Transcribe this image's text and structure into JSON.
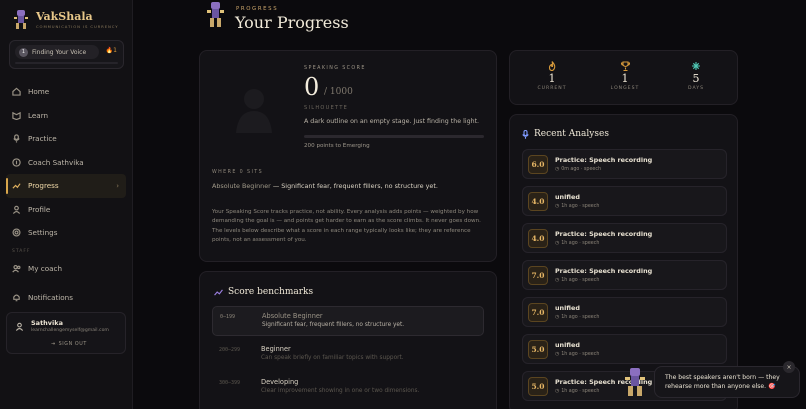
{
  "app": {
    "name": "VakShala",
    "tagline": "COMMUNICATION IS CURRENCY"
  },
  "level_card": {
    "level_number": "1",
    "level_name": "Finding Your Voice",
    "streak": "1"
  },
  "nav": {
    "items": [
      {
        "label": "Home",
        "icon": "home-icon"
      },
      {
        "label": "Learn",
        "icon": "book-icon"
      },
      {
        "label": "Practice",
        "icon": "mic-icon"
      },
      {
        "label": "Coach Sathvika",
        "icon": "coach-icon"
      },
      {
        "label": "Progress",
        "icon": "chart-icon",
        "active": true
      },
      {
        "label": "Profile",
        "icon": "user-icon"
      },
      {
        "label": "Settings",
        "icon": "gear-icon"
      }
    ],
    "staff_section": "STAFF",
    "staff_items": [
      {
        "label": "My coach",
        "icon": "users-icon"
      }
    ],
    "notifications": "Notifications"
  },
  "user": {
    "name": "Sathvika",
    "email": "learnchallengemyself@gmail.com",
    "sign_out": "SIGN OUT"
  },
  "header": {
    "kicker": "PROGRESS",
    "title": "Your Progress"
  },
  "score": {
    "kicker": "SPEAKING SCORE",
    "value": "0",
    "max": "/ 1000",
    "tier": "SILHOUETTE",
    "description": "A dark outline on an empty stage. Just finding the light.",
    "progress_fraction": 0,
    "next": "200 points to Emerging",
    "where_kicker": "WHERE 0 SITS",
    "where_level": "Absolute Beginner",
    "where_desc": " — Significant fear, frequent fillers, no structure yet.",
    "paragraph": "Your Speaking Score tracks practice, not ability. Every analysis adds points — weighted by how demanding the goal is — and points get harder to earn as the score climbs. It never goes down. The levels below describe what a score in each range typically looks like; they are reference points, not an assessment of you."
  },
  "benchmarks": {
    "title": "Score benchmarks",
    "rows": [
      {
        "range": "0–199",
        "name": "Absolute Beginner",
        "desc": "Significant fear, frequent fillers, no structure yet."
      },
      {
        "range": "200–299",
        "name": "Beginner",
        "desc": "Can speak briefly on familiar topics with support."
      },
      {
        "range": "300–399",
        "name": "Developing",
        "desc": "Clear improvement showing in one or two dimensions."
      }
    ]
  },
  "stats": [
    {
      "value": "1",
      "label": "CURRENT",
      "icon": "flame-icon"
    },
    {
      "value": "1",
      "label": "LONGEST",
      "icon": "trophy-icon"
    },
    {
      "value": "5",
      "label": "DAYS",
      "icon": "sparkle-icon"
    }
  ],
  "recent": {
    "title": "Recent Analyses",
    "items": [
      {
        "score": "6.0",
        "title": "Practice: Speech recording",
        "meta": "0m ago · speech"
      },
      {
        "score": "4.0",
        "title": "unified",
        "meta": "1h ago · speech"
      },
      {
        "score": "4.0",
        "title": "Practice: Speech recording",
        "meta": "1h ago · speech"
      },
      {
        "score": "7.0",
        "title": "Practice: Speech recording",
        "meta": "1h ago · speech"
      },
      {
        "score": "7.0",
        "title": "unified",
        "meta": "1h ago · speech"
      },
      {
        "score": "5.0",
        "title": "unified",
        "meta": "1h ago · speech"
      },
      {
        "score": "5.0",
        "title": "Practice: Speech recording",
        "meta": "1h ago · speech"
      }
    ]
  },
  "toast": {
    "text": "The best speakers aren't born — they rehearse more than anyone else. 🎯",
    "close": "×"
  }
}
